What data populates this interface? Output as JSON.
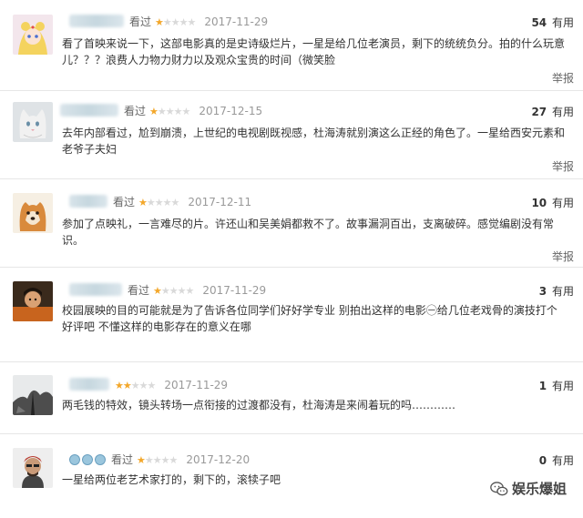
{
  "reviews": [
    {
      "watched_label": "看过",
      "stars": 1,
      "date": "2017-11-29",
      "useful_count": "54",
      "useful_label": "有用",
      "text": "看了首映来说一下，这部电影真的是史诗级烂片，一星是给几位老演员，剩下的统统负分。拍的什么玩意儿？？？浪费人力物力财力以及观众宝贵的时间（微笑脸",
      "report_label": "举报"
    },
    {
      "watched_label": "看过",
      "stars": 1,
      "date": "2017-12-15",
      "useful_count": "27",
      "useful_label": "有用",
      "text": "去年内部看过，尬到崩溃，上世纪的电视剧既视感，杜海涛就别演这么正经的角色了。一星给西安元素和老爷子夫妇",
      "report_label": "举报"
    },
    {
      "watched_label": "看过",
      "stars": 1,
      "date": "2017-12-11",
      "useful_count": "10",
      "useful_label": "有用",
      "text": "参加了点映礼，一言难尽的片。许还山和吴美娟都救不了。故事漏洞百出，支离破碎。感觉编剧没有常识。",
      "report_label": "举报"
    },
    {
      "watched_label": "看过",
      "stars": 1,
      "date": "2017-11-29",
      "useful_count": "3",
      "useful_label": "有用",
      "text": "校园展映的目的可能就是为了告诉各位同学们好好学专业 别拍出这样的电影㊀给几位老戏骨的演技打个好评吧 不懂这样的电影存在的意义在哪",
      "report_label": ""
    },
    {
      "watched_label": "",
      "stars": 2,
      "date": "2017-11-29",
      "useful_count": "1",
      "useful_label": "有用",
      "text": "两毛钱的特效，镜头转场一点衔接的过渡都没有，杜海涛是来闹着玩的吗…………",
      "report_label": ""
    },
    {
      "watched_label": "看过",
      "stars": 1,
      "date": "2017-12-20",
      "useful_count": "0",
      "useful_label": "有用",
      "text": "一星给两位老艺术家打的，剩下的，滚犊子吧",
      "report_label": ""
    }
  ],
  "watermark": {
    "text": "娱乐爆姐",
    "icon": "wechat-icon"
  },
  "colors": {
    "star_on": "#f3a72a",
    "star_off": "#d9d9d9",
    "divider": "#e6e6e6"
  }
}
